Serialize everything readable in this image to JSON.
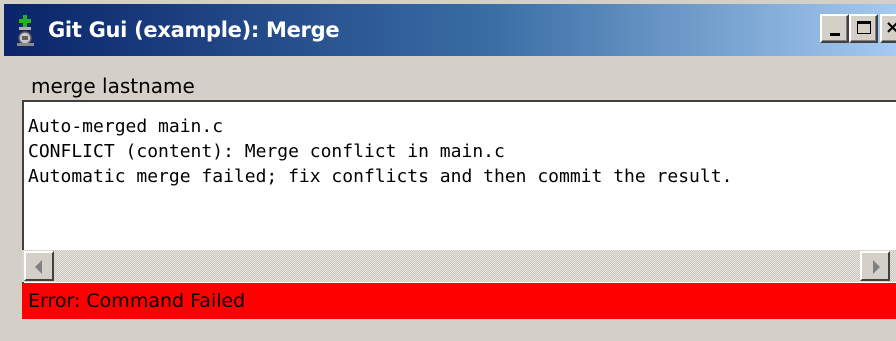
{
  "window": {
    "title": "Git Gui (example): Merge",
    "icon": "git-gui-icon",
    "controls": {
      "minimize_icon": "minimize-icon",
      "maximize_icon": "maximize-icon",
      "close_icon": "close-icon",
      "close_glyph": "×"
    }
  },
  "command_label": "merge lastname",
  "output": {
    "lines": [
      "Auto-merged main.c",
      "CONFLICT (content): Merge conflict in main.c",
      "Automatic merge failed; fix conflicts and then commit the result."
    ]
  },
  "scrollbar": {
    "left_icon": "scroll-left-icon",
    "right_icon": "scroll-right-icon"
  },
  "status": {
    "error_text": "Error: Command Failed",
    "color": "#ff0000"
  },
  "colors": {
    "titlebar_start": "#0a246a",
    "titlebar_end": "#a6caf0",
    "window_bg": "#d4d0c8",
    "app_icon_green": "#1e9a1e"
  }
}
